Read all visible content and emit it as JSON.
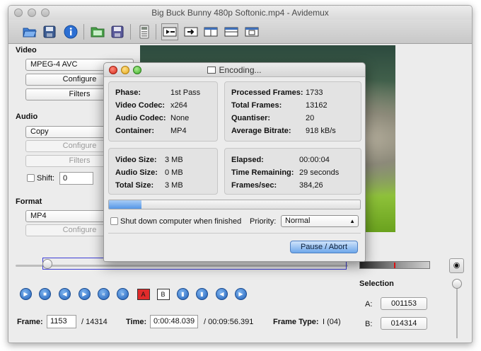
{
  "window": {
    "title": "Big Buck Bunny 480p Softonic.mp4 - Avidemux"
  },
  "toolbar": {
    "icons": [
      "open-folder-icon",
      "save-icon",
      "info-icon",
      "open-image-icon",
      "save-image-icon",
      "calculator-icon",
      "play-filtered-icon",
      "output-icon",
      "split-view-icon",
      "horizontal-split-icon",
      "preview-icon"
    ]
  },
  "video": {
    "section_label": "Video",
    "codec": "MPEG-4 AVC",
    "configure_label": "Configure",
    "filters_label": "Filters"
  },
  "audio": {
    "section_label": "Audio",
    "codec": "Copy",
    "configure_label": "Configure",
    "filters_label": "Filters",
    "shift_label": "Shift:",
    "shift_value": "0"
  },
  "format": {
    "section_label": "Format",
    "container": "MP4",
    "configure_label": "Configure"
  },
  "dialog": {
    "title": "Encoding...",
    "phase_label": "Phase:",
    "phase_value": "1st Pass",
    "vcodec_label": "Video Codec:",
    "vcodec_value": "x264",
    "acodec_label": "Audio Codec:",
    "acodec_value": "None",
    "container_label": "Container:",
    "container_value": "MP4",
    "processed_label": "Processed Frames:",
    "processed_value": "1733",
    "total_label": "Total Frames:",
    "total_value": "13162",
    "quant_label": "Quantiser:",
    "quant_value": "20",
    "bitrate_label": "Average Bitrate:",
    "bitrate_value": "918 kB/s",
    "vsize_label": "Video Size:",
    "vsize_value": "3 MB",
    "asize_label": "Audio Size:",
    "asize_value": "0 MB",
    "tsize_label": "Total Size:",
    "tsize_value": "3 MB",
    "elapsed_label": "Elapsed:",
    "elapsed_value": "00:00:04",
    "remaining_label": "Time Remaining:",
    "remaining_value": "29 seconds",
    "fps_label": "Frames/sec:",
    "fps_value": "384,26",
    "progress_fraction": 0.13,
    "shutdown_label": "Shut down computer when finished",
    "priority_label": "Priority:",
    "priority_value": "Normal",
    "abort_label": "Pause / Abort"
  },
  "navigation": {
    "frame_label": "Frame:",
    "frame_value": "1153",
    "frame_total": "/ 14314",
    "time_label": "Time:",
    "time_value": "0:00:48.039",
    "time_total": "/ 00:09:56.391",
    "frame_type_label": "Frame Type:",
    "frame_type_value": "I (04)"
  },
  "selection": {
    "title": "Selection",
    "a_label": "A:",
    "a_value": "001153",
    "b_label": "B:",
    "b_value": "014314"
  }
}
